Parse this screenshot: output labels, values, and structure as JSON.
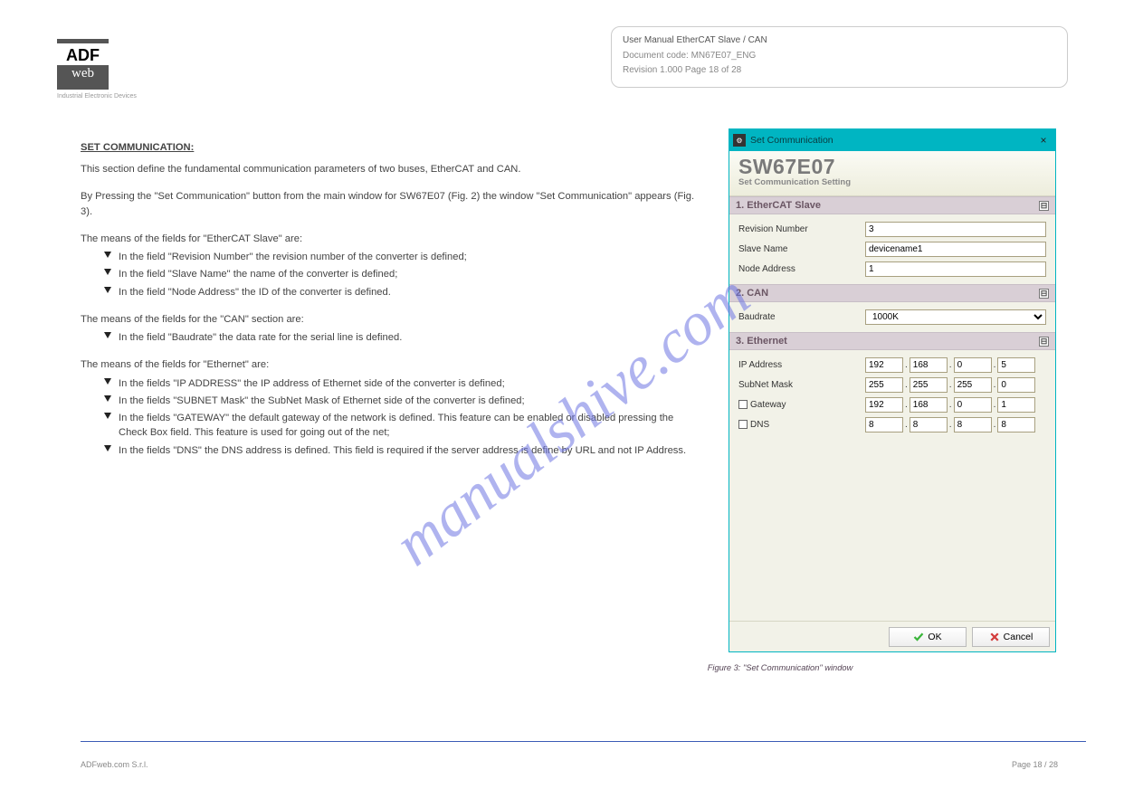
{
  "logo": {
    "top": "ADF",
    "bot": "web",
    "sub": "Industrial Electronic Devices"
  },
  "header": {
    "line1": "User Manual EtherCAT Slave / CAN",
    "line2": "Document code: MN67E07_ENG",
    "line3": "Revision 1.000   Page 18 of 28"
  },
  "section_heading": "SET COMMUNICATION:",
  "intro1": "This section define the fundamental communication parameters of two buses, EtherCAT and CAN.",
  "intro2": "By Pressing the \"Set Communication\" button from the main window for SW67E07 (Fig. 2) the window \"Set Communication\" appears (Fig. 3).",
  "ethercat_head": "The means of the fields for \"EtherCAT Slave\" are:",
  "ethercat_bullets": [
    "In the field \"Revision Number\" the revision number of the converter is defined;",
    "In the field \"Slave Name\" the name of the converter is defined;",
    "In the field \"Node Address\" the ID of the converter is defined."
  ],
  "can_head": "The means of the fields for the \"CAN\" section are:",
  "can_bullets": [
    "In the field \"Baudrate\" the data rate for the serial line is defined."
  ],
  "eth_head": "The means of the fields for \"Ethernet\" are:",
  "eth_bullets": [
    "In the fields \"IP ADDRESS\" the IP address of Ethernet side of the converter is defined;",
    "In the fields \"SUBNET Mask\" the SubNet Mask of Ethernet side of the converter is defined;",
    "In the fields \"GATEWAY\" the default gateway of the network is defined. This feature can be enabled or disabled pressing the Check Box field. This feature is used for going out of the net;",
    "In the fields \"DNS\" the DNS address is defined. This field is required if the server address is define by URL and not IP Address."
  ],
  "fig_caption": "Figure 3: \"Set Communication\" window",
  "watermark": "manualshive.com",
  "footer": {
    "left": "ADFweb.com S.r.l.",
    "right": "Page 18 / 28"
  },
  "dialog": {
    "title": "Set Communication",
    "banner_title": "SW67E07",
    "banner_sub": "Set Communication Setting",
    "sec1": {
      "title": "1. EtherCAT Slave",
      "rev_label": "Revision Number",
      "rev_val": "3",
      "slave_label": "Slave Name",
      "slave_val": "devicename1",
      "node_label": "Node Address",
      "node_val": "1"
    },
    "sec2": {
      "title": "2. CAN",
      "baud_label": "Baudrate",
      "baud_val": "1000K"
    },
    "sec3": {
      "title": "3. Ethernet",
      "ip_label": "IP Address",
      "ip": [
        "192",
        "168",
        "0",
        "5"
      ],
      "sub_label": "SubNet Mask",
      "sub": [
        "255",
        "255",
        "255",
        "0"
      ],
      "gw_label": "Gateway",
      "gw": [
        "192",
        "168",
        "0",
        "1"
      ],
      "dns_label": "DNS",
      "dns": [
        "8",
        "8",
        "8",
        "8"
      ]
    },
    "ok": "OK",
    "cancel": "Cancel",
    "collapse_glyph": "⊟"
  }
}
